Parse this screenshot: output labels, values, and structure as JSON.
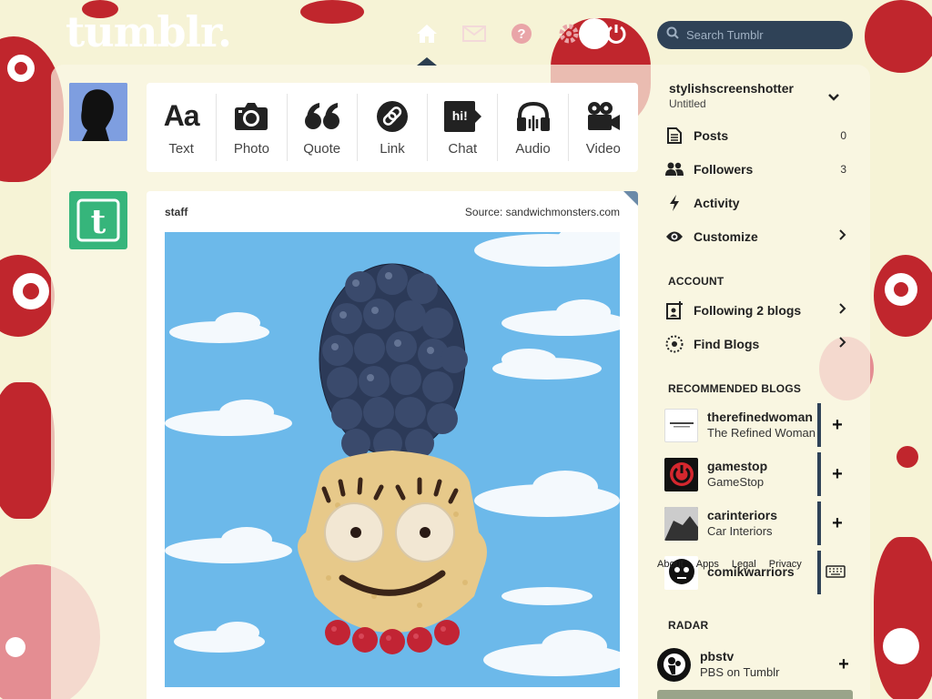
{
  "app": {
    "logo": "tumblr."
  },
  "search": {
    "placeholder": "Search Tumblr"
  },
  "topnav": {
    "icons": [
      "home-icon",
      "mail-icon",
      "help-icon",
      "gear-icon",
      "power-icon"
    ]
  },
  "composer": {
    "buttons": [
      {
        "label": "Text",
        "glyph": "Aa"
      },
      {
        "label": "Photo"
      },
      {
        "label": "Quote",
        "glyph": "66"
      },
      {
        "label": "Link"
      },
      {
        "label": "Chat",
        "glyph": "hi!"
      },
      {
        "label": "Audio"
      },
      {
        "label": "Video"
      }
    ]
  },
  "post": {
    "blog": "staff",
    "source": "Source: sandwichmonsters.com"
  },
  "sidebar": {
    "account_name": "stylishscreenshotter",
    "account_sub": "Untitled",
    "items": [
      {
        "label": "Posts",
        "count": "0"
      },
      {
        "label": "Followers",
        "count": "3"
      },
      {
        "label": "Activity"
      },
      {
        "label": "Customize"
      }
    ],
    "account_head": "ACCOUNT",
    "account_items": [
      {
        "label": "Following 2 blogs"
      },
      {
        "label": "Find Blogs"
      }
    ],
    "recommended_head": "RECOMMENDED BLOGS",
    "recommended": [
      {
        "name": "therefinedwoman",
        "desc": "The Refined Woman"
      },
      {
        "name": "gamestop",
        "desc": "GameStop"
      },
      {
        "name": "carinteriors",
        "desc": "Car Interiors"
      },
      {
        "name": "comikwarriors",
        "desc": ""
      }
    ],
    "footer_links": [
      "About",
      "Apps",
      "Legal",
      "Privacy"
    ],
    "radar_head": "RADAR",
    "radar": {
      "name": "pbstv",
      "desc": "PBS on Tumblr"
    }
  },
  "colors": {
    "accent": "#2f4257",
    "brand_red": "#c0262d",
    "staff_green": "#36b57b",
    "sky": "#6cb9ea"
  }
}
